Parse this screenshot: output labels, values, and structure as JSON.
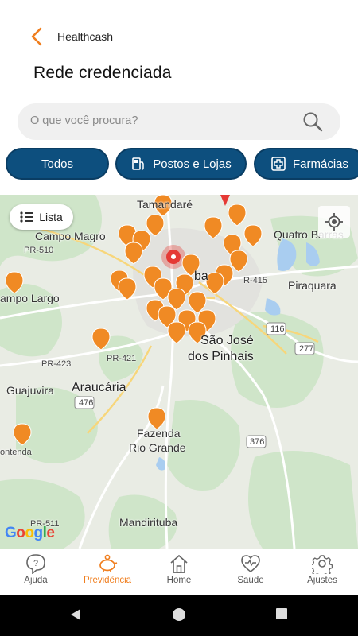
{
  "header": {
    "app_title": "Healthcash",
    "page_title": "Rede credenciada"
  },
  "search": {
    "placeholder": "O que você procura?"
  },
  "filters": [
    {
      "label": "Todos",
      "icon": "none"
    },
    {
      "label": "Postos e Lojas",
      "icon": "gas-pump-icon"
    },
    {
      "label": "Farmácias",
      "icon": "pharmacy-cross-icon"
    }
  ],
  "map": {
    "list_button": "Lista",
    "google": "Google",
    "labels": {
      "tamandare": "Tamandaré",
      "campo_magro": "Campo Magro",
      "quatro_barras": "Quatro Barras",
      "pr510": "PR-510",
      "campo_largo": "ampo Largo",
      "piraquara": "Piraquara",
      "br415": "R-415",
      "ctba": "ba",
      "sjp1": "São José",
      "sjp2": "dos Pinhais",
      "r116": "116",
      "r277": "277",
      "pr423": "PR-423",
      "pr421": "PR-421",
      "guajuvira": "Guajuvira",
      "araucaria": "Araucária",
      "r476": "476",
      "fazenda1": "Fazenda",
      "fazenda2": "Rio Grande",
      "contenda": "ontenda",
      "r376": "376",
      "pr511": "PR-511",
      "mandirituba": "Mandirituba"
    },
    "accent": "#f08a24"
  },
  "nav": [
    {
      "label": "Ajuda",
      "icon": "help-icon",
      "active": false
    },
    {
      "label": "Previdência",
      "icon": "piggy-bank-icon",
      "active": true
    },
    {
      "label": "Home",
      "icon": "home-icon",
      "active": false
    },
    {
      "label": "Saúde",
      "icon": "heart-pulse-icon",
      "active": false
    },
    {
      "label": "Ajustes",
      "icon": "settings-icon",
      "active": false
    }
  ],
  "colors": {
    "primary": "#0d4f7e",
    "accent": "#f07e1e"
  }
}
